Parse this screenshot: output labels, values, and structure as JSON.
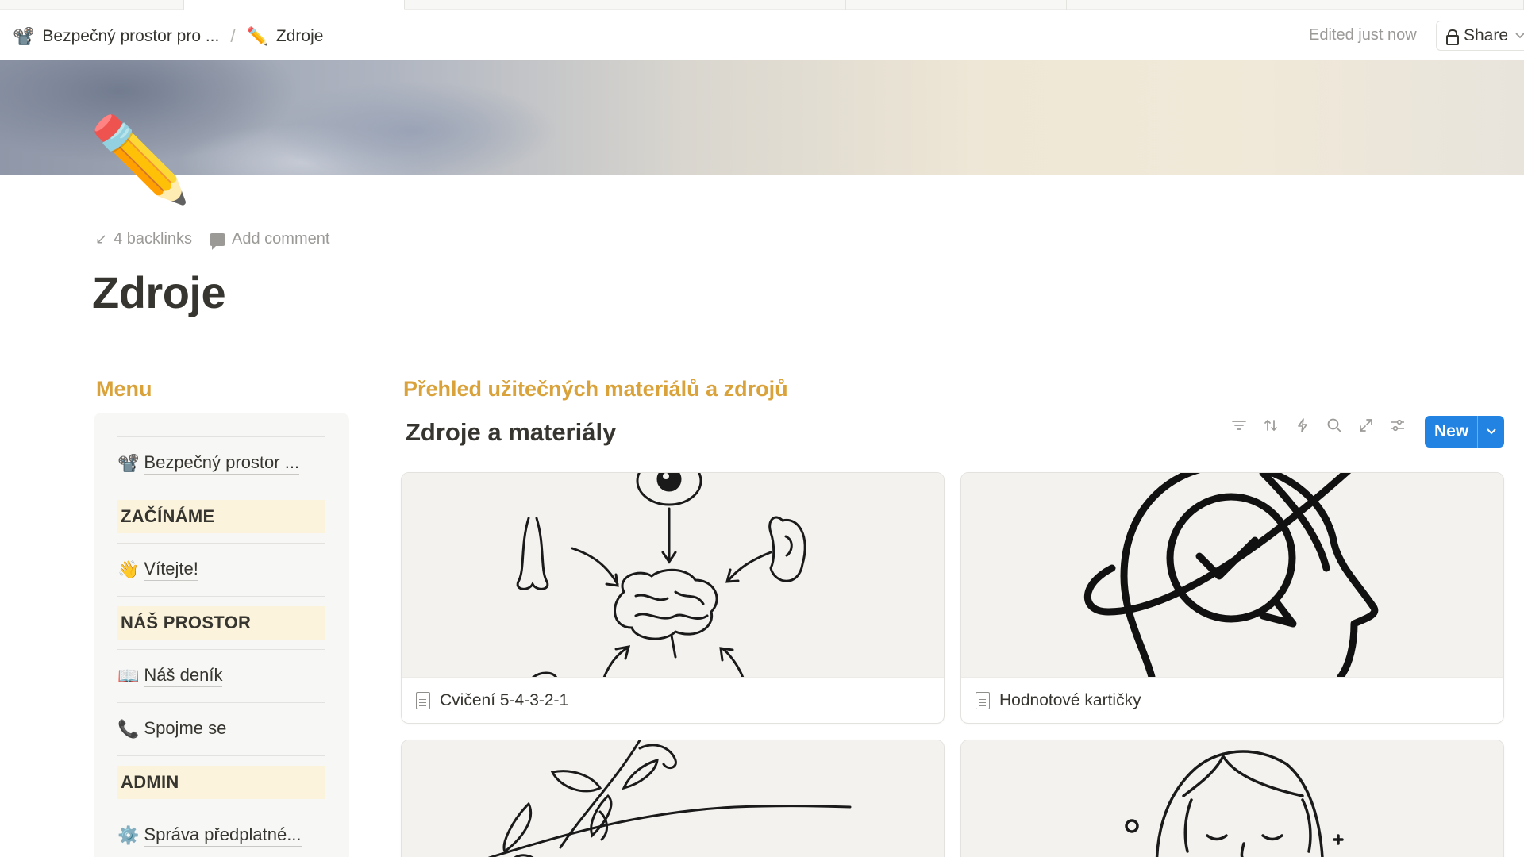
{
  "topbar": {
    "crumbs": [
      {
        "emoji": "📽️",
        "label": "Bezpečný prostor pro ..."
      },
      {
        "emoji": "✏️",
        "label": "Zdroje"
      }
    ],
    "separator": "/",
    "edited": "Edited just now",
    "share_label": "Share"
  },
  "page": {
    "icon": "✏️",
    "backlinks": "4 backlinks",
    "add_comment": "Add comment",
    "title": "Zdroje"
  },
  "menu": {
    "heading": "Menu",
    "rows": [
      {
        "type": "link",
        "emoji": "📽️",
        "label": "Bezpečný prostor ..."
      },
      {
        "type": "section",
        "label": "ZAČÍNÁME"
      },
      {
        "type": "link",
        "emoji": "👋",
        "label": "Vítejte!"
      },
      {
        "type": "section",
        "label": "NÁŠ PROSTOR"
      },
      {
        "type": "link",
        "emoji": "📖",
        "label": "Náš deník"
      },
      {
        "type": "link",
        "emoji": "📞",
        "label": "Spojme se"
      },
      {
        "type": "section",
        "label": "ADMIN"
      },
      {
        "type": "link",
        "emoji": "⚙️",
        "label": "Správa předplatné..."
      }
    ]
  },
  "main": {
    "heading": "Přehled užitečných materiálů a zdrojů",
    "database_title": "Zdroje a materiály",
    "toolbar_icons": [
      "filter-icon",
      "sort-icon",
      "lightning-icon",
      "search-icon",
      "expand-icon",
      "settings-icon"
    ],
    "new_label": "New",
    "cards": [
      {
        "title": "Cvičení 5-4-3-2-1",
        "image": "senses-brain-illustration"
      },
      {
        "title": "Hodnotové kartičky",
        "image": "head-checkmark-illustration"
      },
      {
        "title": "",
        "image": "branch-leaves-illustration"
      },
      {
        "title": "",
        "image": "girl-face-illustration"
      }
    ]
  },
  "colors": {
    "accent_blue": "#2383e2",
    "heading_gold": "#d9a23a",
    "section_bg": "#fbf3db",
    "text": "#37352f",
    "muted": "#9b9a97"
  }
}
